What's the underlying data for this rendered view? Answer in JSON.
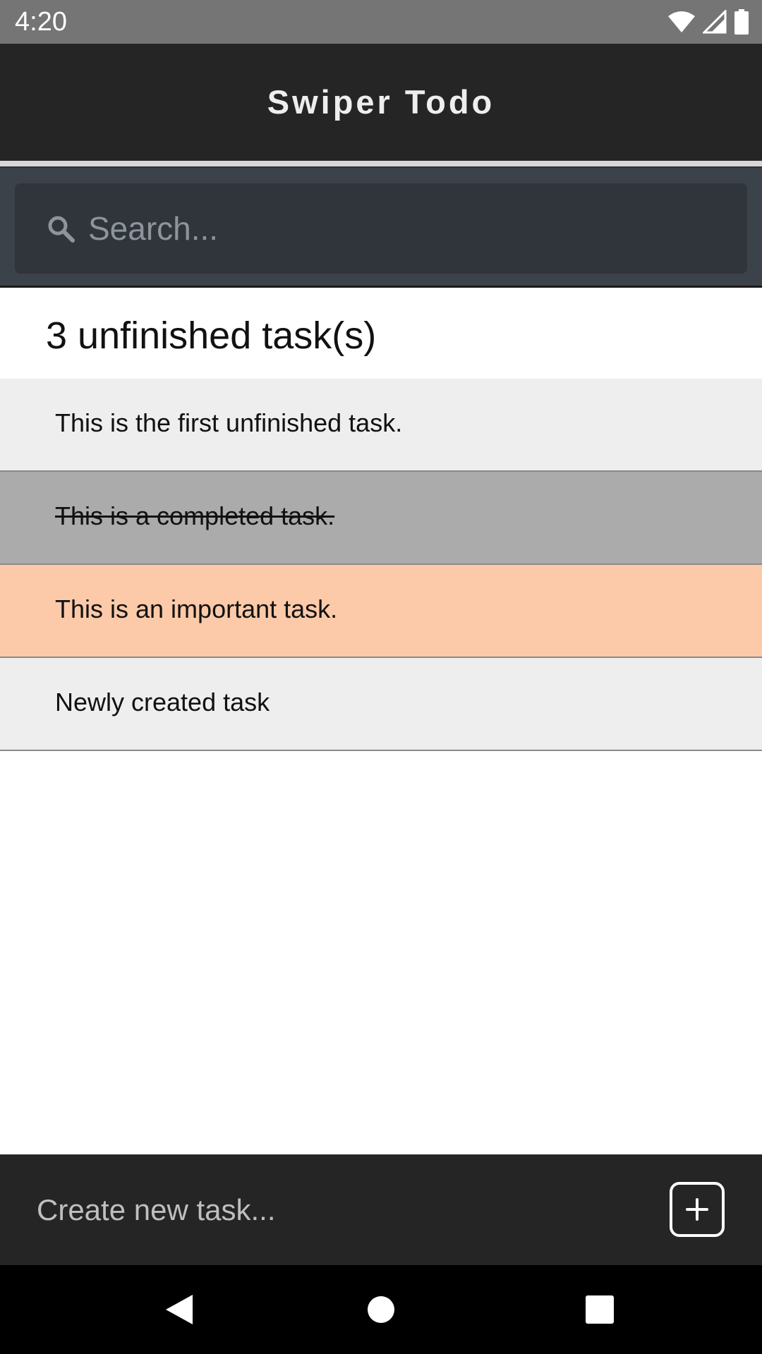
{
  "status_bar": {
    "time": "4:20",
    "icons": [
      "wifi-icon",
      "signal-icon",
      "battery-icon"
    ]
  },
  "app_bar": {
    "title": "Swiper Todo"
  },
  "search": {
    "placeholder": "Search...",
    "value": ""
  },
  "summary": {
    "unfinished_text": "3 unfinished task(s)"
  },
  "tasks": [
    {
      "text": "This is the first unfinished task.",
      "state": "unfinished",
      "background": "#eeeeee"
    },
    {
      "text": "This is a completed task.",
      "state": "completed",
      "background": "#ababab"
    },
    {
      "text": "This is an important task.",
      "state": "important",
      "background": "#fccaa8"
    },
    {
      "text": "Newly created task",
      "state": "unfinished",
      "background": "#eeeeee"
    }
  ],
  "create": {
    "placeholder": "Create new task...",
    "value": "",
    "button_icon": "plus-icon"
  },
  "nav": {
    "icons": [
      "back-icon",
      "home-icon",
      "recents-icon"
    ]
  },
  "colors": {
    "app_bar": "#252525",
    "search_section": "#3b4249",
    "search_box": "#30353b",
    "important": "#fccaa8",
    "completed": "#ababab",
    "default_task": "#eeeeee"
  }
}
